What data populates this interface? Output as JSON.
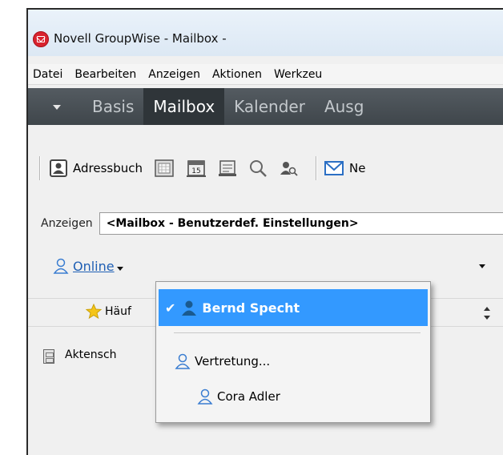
{
  "window": {
    "title": "Novell GroupWise - Mailbox -"
  },
  "menubar": {
    "items": [
      "Datei",
      "Bearbeiten",
      "Anzeigen",
      "Aktionen",
      "Werkzeu"
    ]
  },
  "nav": {
    "tabs": [
      "Basis",
      "Mailbox",
      "Kalender",
      "Ausg"
    ],
    "active": "Mailbox"
  },
  "toolbar": {
    "addressbook_label": "Adressbuch",
    "new_label": "Ne",
    "calendar_day": "15"
  },
  "show": {
    "label": "Anzeigen",
    "value": "<Mailbox - Benutzerdef. Einstellungen>"
  },
  "status": {
    "text": "Online"
  },
  "folders": {
    "favorites_label": "Häuf",
    "cabinet_label": "Aktensch"
  },
  "dropdown": {
    "selected_user": "Bernd Specht",
    "proxy_label": "Vertretung...",
    "other_user": "Cora Adler"
  },
  "colors": {
    "highlight": "#3399ff",
    "link": "#1f5fb4",
    "brand": "#d9232e",
    "nav_bg": "#454c51"
  }
}
